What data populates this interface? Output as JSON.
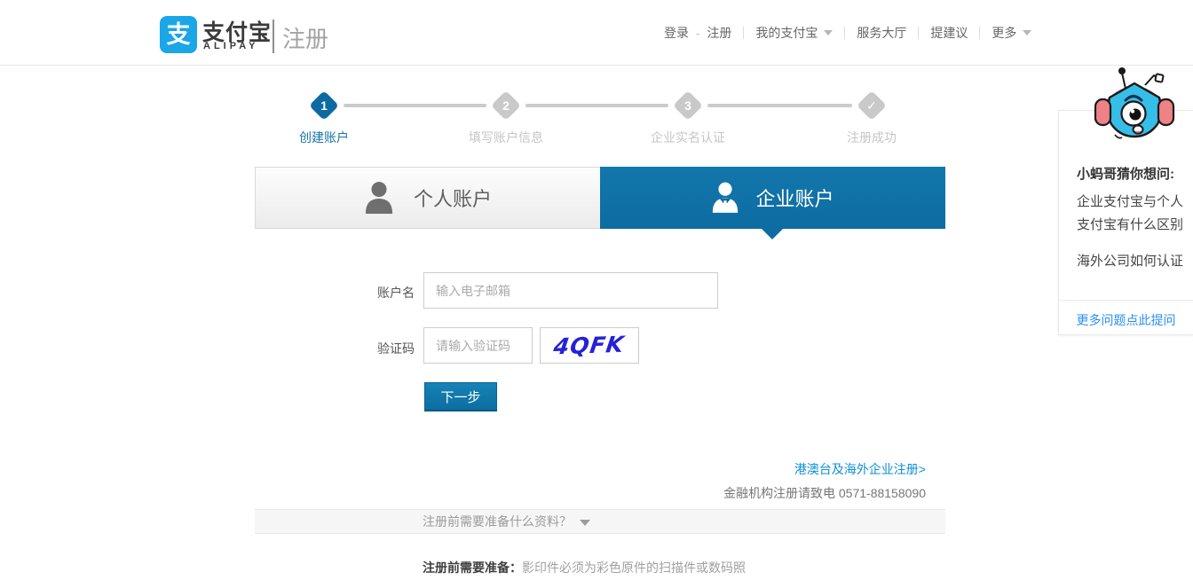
{
  "header": {
    "logo": {
      "icon_glyph": "支",
      "brand_cn": "支付宝",
      "brand_en": "ALIPAY",
      "page_title": "注册"
    },
    "nav": {
      "login": "登录",
      "dash": "-",
      "register": "注册",
      "my_alipay": "我的支付宝",
      "service_hall": "服务大厅",
      "suggestions": "提建议",
      "more": "更多"
    }
  },
  "steps": [
    {
      "num": "1",
      "label": "创建账户"
    },
    {
      "num": "2",
      "label": "填写账户信息"
    },
    {
      "num": "3",
      "label": "企业实名认证"
    },
    {
      "num": "✓",
      "label": "注册成功"
    }
  ],
  "tabs": {
    "personal": "个人账户",
    "enterprise": "企业账户"
  },
  "form": {
    "account_label": "账户名",
    "account_placeholder": "输入电子邮箱",
    "captcha_label": "验证码",
    "captcha_placeholder": "请输入验证码",
    "captcha_text": "4QFK",
    "next_button": "下一步",
    "overseas_link": "港澳台及海外企业注册>",
    "finance_note": "金融机构注册请致电 0571-88158090"
  },
  "prep": {
    "question": "注册前需要准备什么资料？",
    "note_label": "注册前需要准备：",
    "note_text": "影印件必须为彩色原件的扫描件或数码照"
  },
  "sidebar": {
    "title": "小蚂哥猜你想问:",
    "question_1": "企业支付宝与个人支付宝有什么区别",
    "question_2": "海外公司如何认证",
    "more_link": "更多问题点此提问"
  },
  "icons": {
    "logo": "alipay-logo",
    "personal_tab": "person-silhouette",
    "enterprise_tab": "business-person",
    "step_done": "checkmark",
    "mascot": "robot-ant-mascot",
    "carets": "dropdown-caret"
  },
  "colors": {
    "brand_blue": "#1ba6e8",
    "tab_active_blue": "#0e70a6",
    "button_blue": "#1177a9",
    "step_active_blue": "#0c6aa0",
    "link_blue": "#0d90d8",
    "sidebar_link_blue": "#2a8ff0",
    "captcha_text_blue": "#2521d8"
  }
}
